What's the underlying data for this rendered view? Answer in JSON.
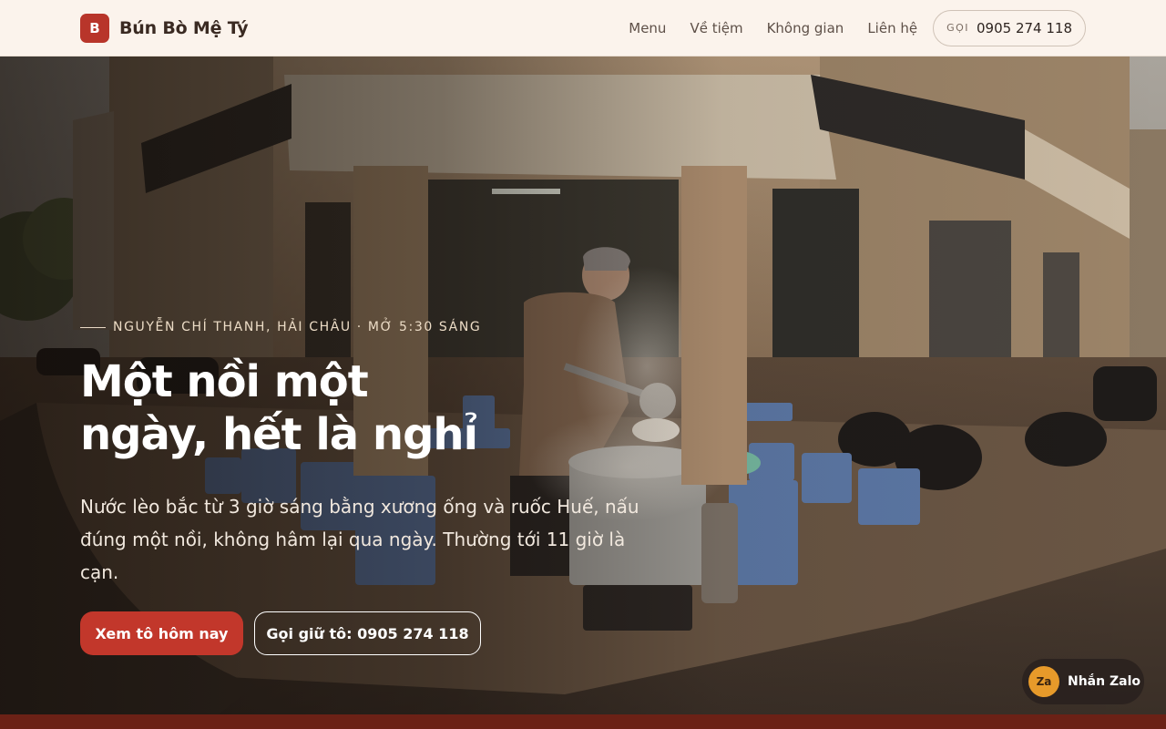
{
  "brand": {
    "logo_letter": "B",
    "name": "Bún Bò Mệ Tý"
  },
  "nav": {
    "items": [
      {
        "label": "Menu"
      },
      {
        "label": "Về tiệm"
      },
      {
        "label": "Không gian"
      },
      {
        "label": "Liên hệ"
      }
    ],
    "call_prefix": "GỌI",
    "call_number": "0905 274 118"
  },
  "hero": {
    "eyebrow": "NGUYỄN CHÍ THANH, HẢI CHÂU · MỞ 5:30 SÁNG",
    "headline_line1": "Một nồi một",
    "headline_line2": "ngày, hết là nghỉ",
    "lede": "Nước lèo bắc từ 3 giờ sáng bằng xương ống và ruốc Huế, nấu đúng một nồi, không hâm lại qua ngày. Thường tới 11 giờ là cạn.",
    "primary_cta": "Xem tô hôm nay",
    "secondary_cta": "Gọi giữ tô: 0905 274 118"
  },
  "zalo": {
    "badge": "Za",
    "label": "Nhắn Zalo"
  },
  "colors": {
    "accent": "#c2372b",
    "header_bg": "#fbf3ec",
    "footer_strip": "#6b2116",
    "zalo_badge": "#e79a2a"
  },
  "icons": {
    "logo": "brand-logo-icon",
    "zalo": "zalo-icon"
  }
}
